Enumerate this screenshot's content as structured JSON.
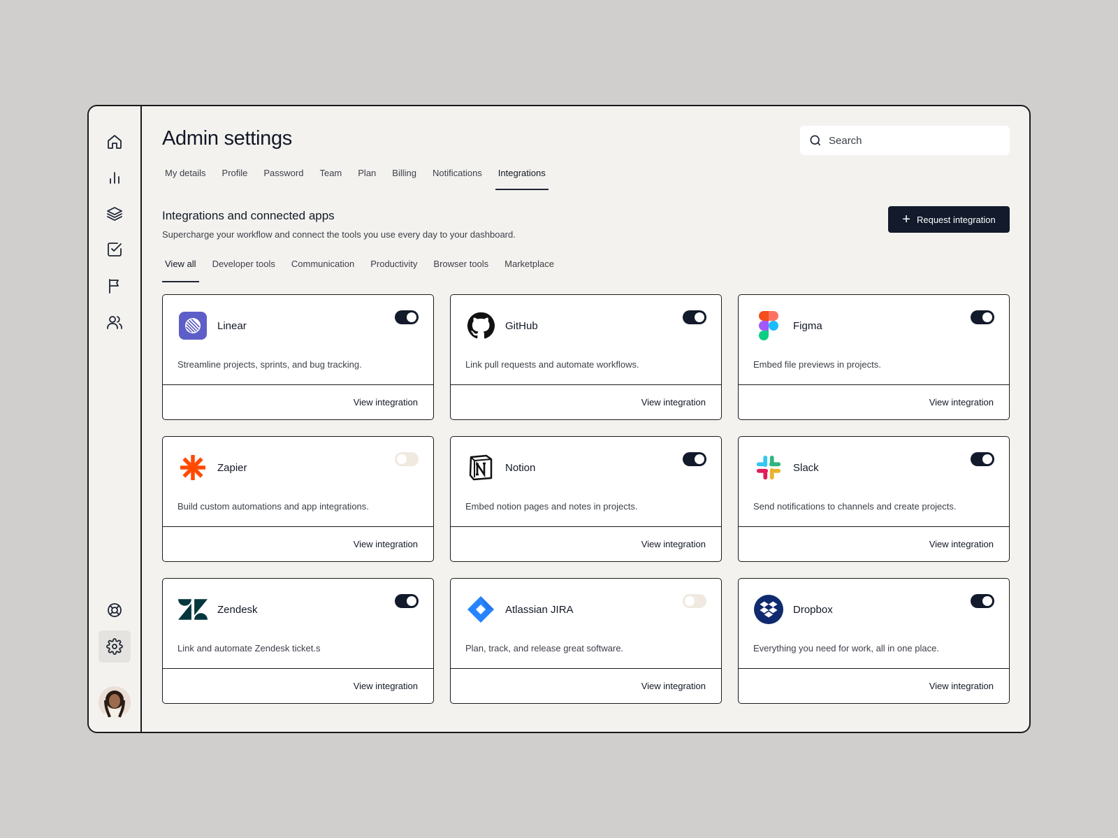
{
  "header": {
    "title": "Admin settings",
    "search_placeholder": "Search"
  },
  "tabs": [
    {
      "label": "My details"
    },
    {
      "label": "Profile"
    },
    {
      "label": "Password"
    },
    {
      "label": "Team"
    },
    {
      "label": "Plan"
    },
    {
      "label": "Billing"
    },
    {
      "label": "Notifications"
    },
    {
      "label": "Integrations",
      "active": true
    }
  ],
  "section": {
    "title": "Integrations and connected apps",
    "subtitle": "Supercharge your workflow and connect the tools you use every day to your dashboard.",
    "request_button": "Request integration"
  },
  "filters": [
    {
      "label": "View all",
      "active": true
    },
    {
      "label": "Developer tools"
    },
    {
      "label": "Communication"
    },
    {
      "label": "Productivity"
    },
    {
      "label": "Browser tools"
    },
    {
      "label": "Marketplace"
    }
  ],
  "integrations": [
    {
      "name": "Linear",
      "description": "Streamline projects, sprints, and bug tracking.",
      "enabled": true,
      "link": "View integration",
      "icon": "linear-logo"
    },
    {
      "name": "GitHub",
      "description": "Link pull requests and automate workflows.",
      "enabled": true,
      "link": "View integration",
      "icon": "github-logo"
    },
    {
      "name": "Figma",
      "description": "Embed file previews in projects.",
      "enabled": true,
      "link": "View integration",
      "icon": "figma-logo"
    },
    {
      "name": "Zapier",
      "description": "Build custom automations and app integrations.",
      "enabled": false,
      "link": "View integration",
      "icon": "zapier-logo"
    },
    {
      "name": "Notion",
      "description": "Embed notion pages and notes in projects.",
      "enabled": true,
      "link": "View integration",
      "icon": "notion-logo"
    },
    {
      "name": "Slack",
      "description": "Send notifications to channels and create projects.",
      "enabled": true,
      "link": "View integration",
      "icon": "slack-logo"
    },
    {
      "name": "Zendesk",
      "description": "Link and automate Zendesk ticket.s",
      "enabled": true,
      "link": "View integration",
      "icon": "zendesk-logo"
    },
    {
      "name": "Atlassian JIRA",
      "description": "Plan, track, and release great software.",
      "enabled": false,
      "link": "View integration",
      "icon": "jira-logo"
    },
    {
      "name": "Dropbox",
      "description": "Everything you need for work, all in one place.",
      "enabled": true,
      "link": "View integration",
      "icon": "dropbox-logo"
    }
  ],
  "sidebar": {
    "items": [
      {
        "icon": "home-icon"
      },
      {
        "icon": "bar-chart-icon"
      },
      {
        "icon": "layers-icon"
      },
      {
        "icon": "check-square-icon"
      },
      {
        "icon": "flag-icon"
      },
      {
        "icon": "users-icon"
      }
    ],
    "bottom": [
      {
        "icon": "support-icon"
      },
      {
        "icon": "settings-icon",
        "active": true
      }
    ]
  },
  "colors": {
    "accent": "#121a2b",
    "page_background": "#f4f2ef",
    "toggle_off": "#efe9df"
  }
}
